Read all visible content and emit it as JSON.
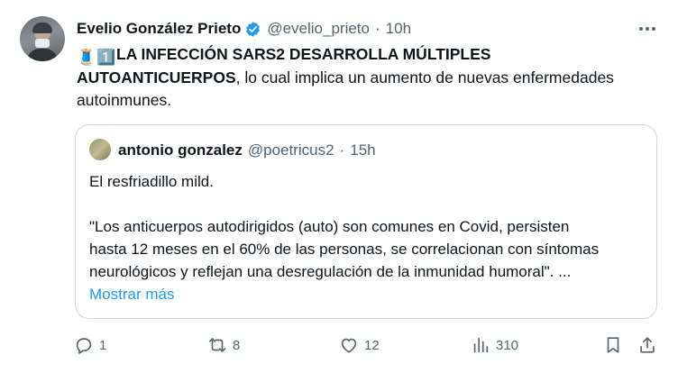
{
  "author": {
    "name": "Evelio González Prieto",
    "handle": "@evelio_prieto",
    "sep": "·",
    "time": "10h",
    "verified_icon": "verified-badge-icon"
  },
  "tweet": {
    "emoji1": "🧵",
    "emoji2": "1️⃣",
    "bold_line1": "LA INFECCIÓN SARS2 DESARROLLA MÚLTIPLES",
    "bold_line2": "AUTOANTICUERPOS",
    "rest_line2": ", lo cual implica un aumento de nuevas enfermedades",
    "line3": "autoinmunes."
  },
  "quote": {
    "name": "antonio gonzalez",
    "handle": "@poetricus2",
    "sep": "·",
    "time": "15h",
    "line1": "El resfriadillo mild.",
    "line2": "\"Los anticuerpos autodirigidos (auto) son comunes en Covid, persisten",
    "line3": "hasta 12 meses en el 60% de las personas, se correlacionan con síntomas",
    "line4": "neurológicos y reflejan una desregulación de la inmunidad humoral\". ...",
    "show_more": "Mostrar más"
  },
  "actions": {
    "reply_count": "1",
    "retweet_count": "8",
    "like_count": "12",
    "views_count": "310"
  },
  "colors": {
    "text": "#0f1419",
    "secondary": "#536471",
    "link": "#1d9bf0",
    "verified": "#1d9bf0",
    "border": "#cfd9de"
  }
}
